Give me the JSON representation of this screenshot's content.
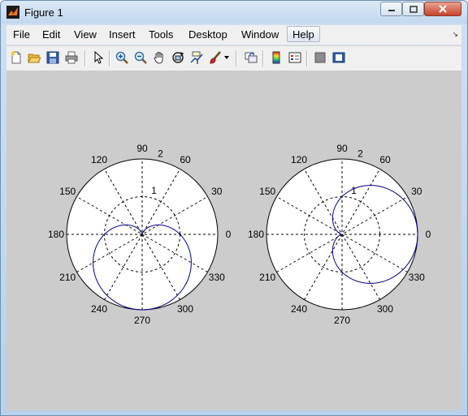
{
  "window": {
    "title": "Figure 1"
  },
  "menu": [
    "File",
    "Edit",
    "View",
    "Insert",
    "Tools",
    "Desktop",
    "Window",
    "Help"
  ],
  "menu_highlighted": "Help",
  "toolbar_icons": [
    "new-figure-icon",
    "open-file-icon",
    "save-icon",
    "print-icon",
    "pointer-icon",
    "zoom-in-icon",
    "zoom-out-icon",
    "pan-hand-icon",
    "rotate-3d-icon",
    "data-cursor-icon",
    "brush-icon",
    "brush-dropdown-icon",
    "link-plot-icon",
    "colorbar-icon",
    "legend-icon",
    "hide-plot-tools-icon",
    "show-plot-tools-icon"
  ],
  "colors": {
    "curve": "#00008b",
    "canvas": "#cccccc",
    "axes_bg": "#ffffff"
  },
  "chart_data": [
    {
      "type": "polar",
      "rmax": 2,
      "radial_ticks": [
        "1",
        "2"
      ],
      "angle_ticks": [
        "0",
        "30",
        "60",
        "90",
        "120",
        "150",
        "180",
        "210",
        "240",
        "270",
        "300",
        "330"
      ],
      "series": [
        {
          "r": "1 - sin(theta)",
          "theta_deg": [
            0,
            15,
            30,
            45,
            60,
            75,
            90,
            105,
            120,
            135,
            150,
            165,
            180,
            195,
            210,
            225,
            240,
            255,
            270,
            285,
            300,
            315,
            330,
            345,
            360
          ]
        }
      ]
    },
    {
      "type": "polar",
      "rmax": 2,
      "radial_ticks": [
        "1",
        "2"
      ],
      "angle_ticks": [
        "0",
        "30",
        "60",
        "90",
        "120",
        "150",
        "180",
        "210",
        "240",
        "270",
        "300",
        "330"
      ],
      "series": [
        {
          "r": "1 + cos(theta)",
          "theta_deg": [
            0,
            15,
            30,
            45,
            60,
            75,
            90,
            105,
            120,
            135,
            150,
            165,
            180,
            195,
            210,
            225,
            240,
            255,
            270,
            285,
            300,
            315,
            330,
            345,
            360
          ]
        }
      ]
    }
  ]
}
